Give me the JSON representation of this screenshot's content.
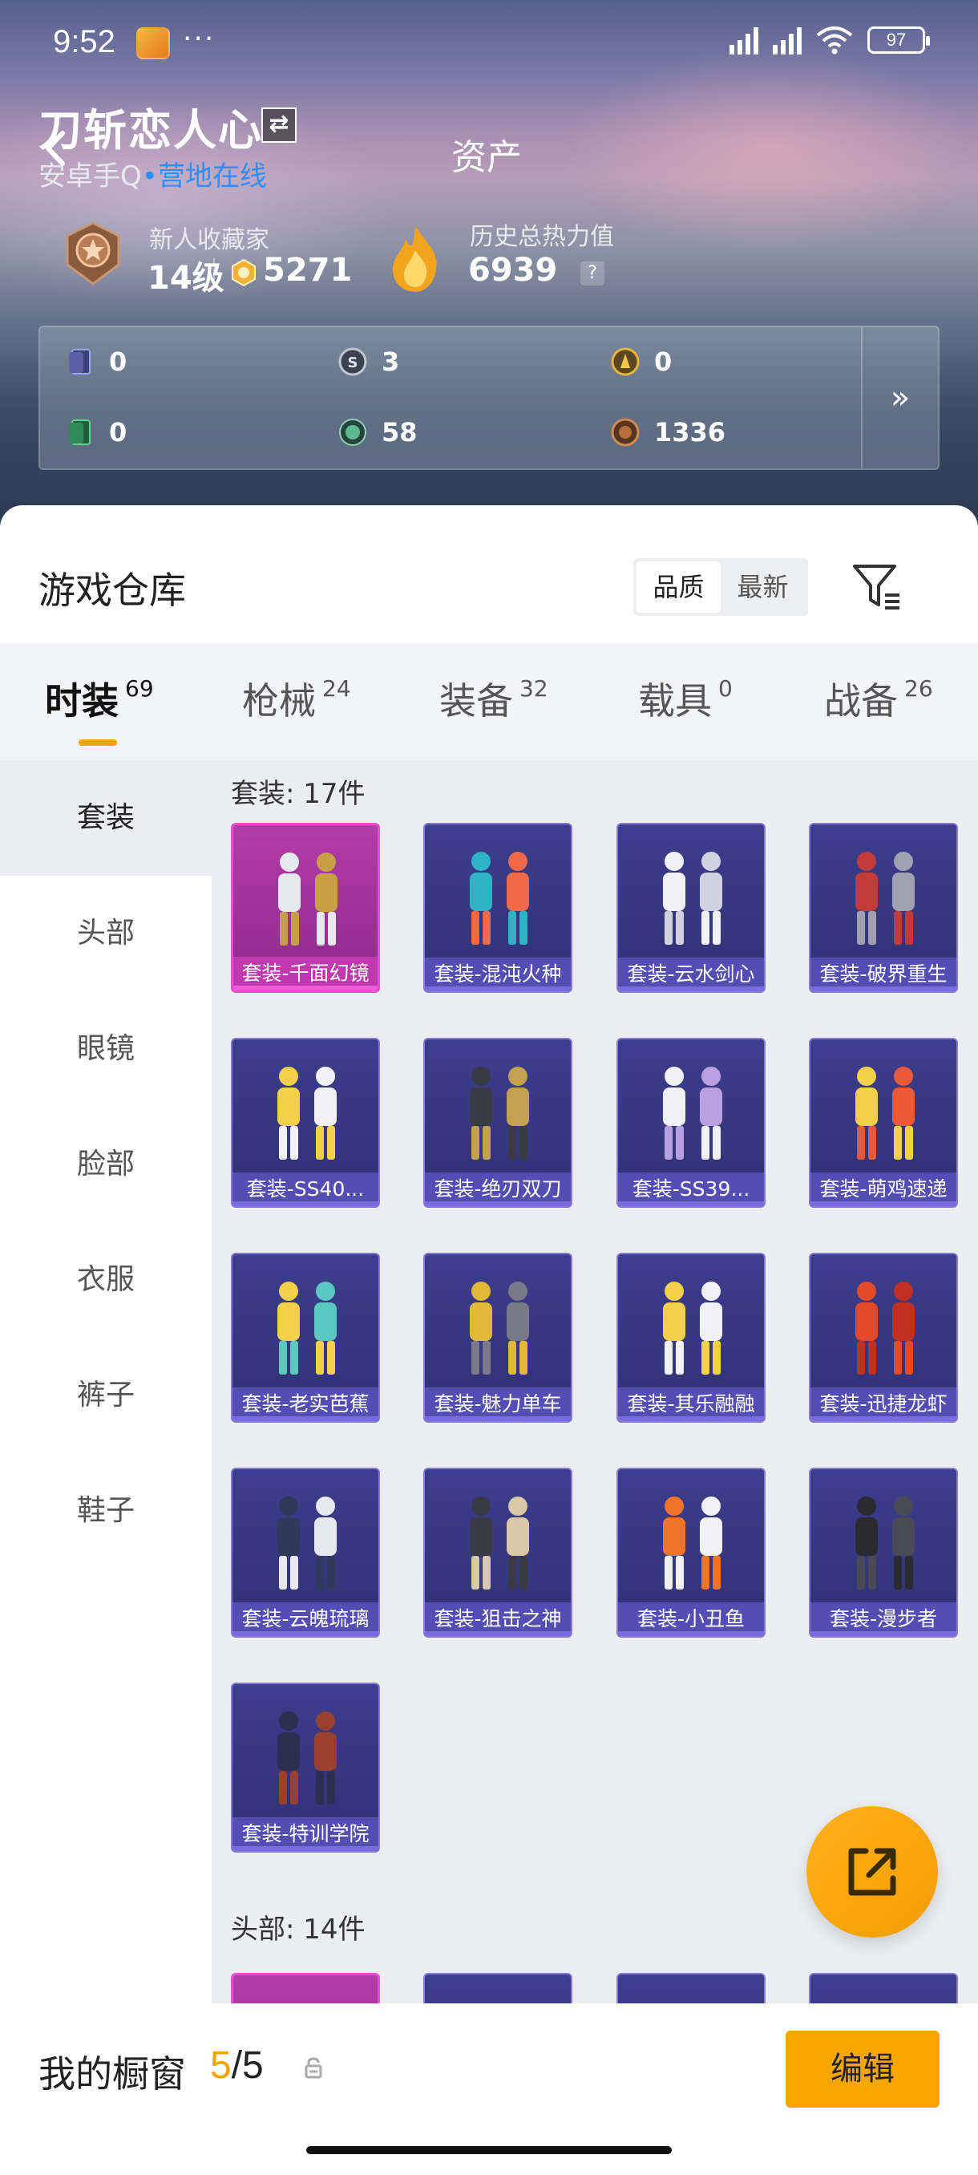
{
  "status_bar": {
    "time": "9:52",
    "dots": "···",
    "battery": "97"
  },
  "header": {
    "user_name": "刀斩恋人心",
    "platform": "安卓手Q",
    "online_status": "营地在线",
    "page_title": "资产",
    "collector_title": "新人收藏家",
    "level": "14级",
    "coins": "5271",
    "heat_label": "历史总热力值",
    "heat_value": "6939",
    "help": "?"
  },
  "assets": [
    {
      "icon": "card-icon",
      "value": "0"
    },
    {
      "icon": "silver-coin-icon",
      "value": "3"
    },
    {
      "icon": "gold-coin-icon",
      "value": "0"
    },
    {
      "icon": "green-card-icon",
      "value": "0"
    },
    {
      "icon": "gem-icon",
      "value": "58"
    },
    {
      "icon": "bronze-coin-icon",
      "value": "1336"
    }
  ],
  "assets_more": "»",
  "warehouse": {
    "title": "游戏仓库",
    "sort_options": [
      "品质",
      "最新"
    ],
    "sort_selected": "品质"
  },
  "tabs": [
    {
      "label": "时装",
      "count": "69",
      "active": true
    },
    {
      "label": "枪械",
      "count": "24",
      "active": false
    },
    {
      "label": "装备",
      "count": "32",
      "active": false
    },
    {
      "label": "载具",
      "count": "0",
      "active": false
    },
    {
      "label": "战备",
      "count": "26",
      "active": false
    }
  ],
  "sidebar": [
    "套装",
    "头部",
    "眼镜",
    "脸部",
    "衣服",
    "裤子",
    "鞋子"
  ],
  "sections": [
    {
      "title": "套装: 17件",
      "items": [
        "套装-千面幻镜",
        "套装-混沌火种",
        "套装-云水剑心",
        "套装-破界重生",
        "套装-SS40...",
        "套装-绝刃双刀",
        "套装-SS39...",
        "套装-萌鸡速递",
        "套装-老实芭蕉",
        "套装-魅力单车",
        "套装-其乐融融",
        "套装-迅捷龙虾",
        "套装-云魄琉璃",
        "套装-狙击之神",
        "套装-小丑鱼",
        "套装-漫步者",
        "套装-特训学院"
      ]
    },
    {
      "title": "头部: 14件"
    }
  ],
  "bottom": {
    "showcase_label": "我的橱窗",
    "showcase_current": "5",
    "showcase_sep": "/",
    "showcase_total": "5",
    "edit_label": "编辑"
  },
  "colors": {
    "accent": "#f5a300",
    "online": "#2f8fff",
    "card_epic": "#3c3e8e",
    "card_legend": "#b43ca8"
  }
}
